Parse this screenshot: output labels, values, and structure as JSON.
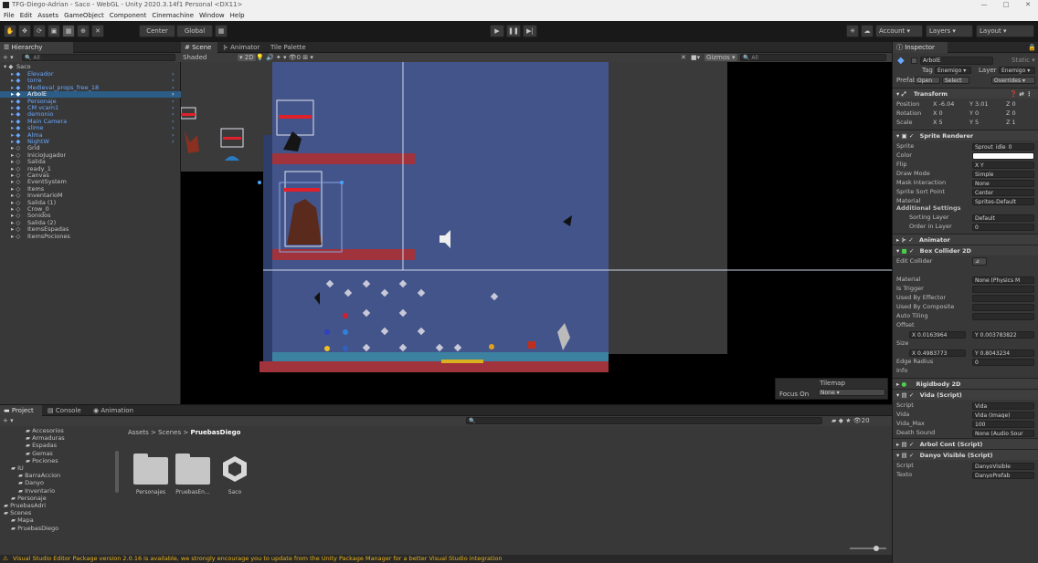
{
  "window": {
    "title": "TFG-Diego-Adrian - Saco - WebGL - Unity 2020.3.14f1 Personal <DX11>",
    "minimize": "—",
    "maximize": "□",
    "close": "✕"
  },
  "menu": [
    "File",
    "Edit",
    "Assets",
    "GameObject",
    "Component",
    "Cinemachine",
    "Window",
    "Help"
  ],
  "toolbar": {
    "center": "Center",
    "global": "Global",
    "account": "Account",
    "layers": "Layers",
    "layout": "Layout"
  },
  "hierarchy": {
    "tab": "Hierarchy",
    "search_placeholder": "All",
    "scene": "Saco",
    "items": [
      {
        "label": "Elevador",
        "blue": true
      },
      {
        "label": "torre",
        "blue": true
      },
      {
        "label": "Medieval_props_free_18",
        "blue": true
      },
      {
        "label": "ArbolE",
        "blue": true,
        "selected": true
      },
      {
        "label": "Personaje",
        "blue": true
      },
      {
        "label": "CM vcam1",
        "blue": true
      },
      {
        "label": "demonio",
        "blue": true
      },
      {
        "label": "Main Camera",
        "blue": true
      },
      {
        "label": "slime",
        "blue": true
      },
      {
        "label": "Alma",
        "blue": true
      },
      {
        "label": "NightW",
        "blue": true
      },
      {
        "label": "Grid",
        "blue": false
      },
      {
        "label": "InicioJugador",
        "blue": false
      },
      {
        "label": "Salida",
        "blue": false
      },
      {
        "label": "ready_1",
        "blue": false
      },
      {
        "label": "Canvas",
        "blue": false
      },
      {
        "label": "EventSystem",
        "blue": false
      },
      {
        "label": "Items",
        "blue": false
      },
      {
        "label": "InventarioM",
        "blue": false
      },
      {
        "label": "Salida (1)",
        "blue": false
      },
      {
        "label": "Crow_0",
        "blue": false
      },
      {
        "label": "Sonidos",
        "blue": false
      },
      {
        "label": "Salida (2)",
        "blue": false
      },
      {
        "label": "ItemsEspadas",
        "blue": false
      },
      {
        "label": "ItemsPociones",
        "blue": false
      }
    ]
  },
  "scene_view": {
    "tabs": [
      "Scene",
      "Animator",
      "Tile Palette"
    ],
    "shading": "Shaded",
    "mode_2d": "2D",
    "gizmos": "Gizmos",
    "search_placeholder": "All",
    "tilemap_title": "Tilemap",
    "focus_on": "Focus On",
    "focus_value": "None"
  },
  "inspector": {
    "tab": "Inspector",
    "object_name": "ArbolE",
    "static_label": "Static",
    "tag_label": "Tag",
    "tag_value": "Enemigo",
    "layer_label": "Layer",
    "layer_value": "Enemigo",
    "prefab_label": "Prefab",
    "open": "Open",
    "select": "Select",
    "overrides": "Overrides",
    "transform": {
      "title": "Transform",
      "position_label": "Position",
      "position": {
        "x": "-6.04",
        "y": "3.01",
        "z": "0"
      },
      "rotation_label": "Rotation",
      "rotation": {
        "x": "0",
        "y": "0",
        "z": "0"
      },
      "scale_label": "Scale",
      "scale": {
        "x": "5",
        "y": "5",
        "z": "1"
      }
    },
    "sprite_renderer": {
      "title": "Sprite Renderer",
      "rows": [
        {
          "label": "Sprite",
          "value": "Sprout_idle_0"
        },
        {
          "label": "Color",
          "value": ""
        },
        {
          "label": "Flip",
          "value": "X   Y"
        },
        {
          "label": "Draw Mode",
          "value": "Simple"
        },
        {
          "label": "Mask Interaction",
          "value": "None"
        },
        {
          "label": "Sprite Sort Point",
          "value": "Center"
        },
        {
          "label": "Material",
          "value": "Sprites-Default"
        }
      ],
      "additional": "Additional Settings",
      "sorting_layer_label": "Sorting Layer",
      "sorting_layer": "Default",
      "order_label": "Order in Layer",
      "order": "0"
    },
    "animator": {
      "title": "Animator"
    },
    "box_collider": {
      "title": "Box Collider 2D",
      "edit_collider": "Edit Collider",
      "rows": [
        {
          "label": "Material",
          "value": "None (Physics M"
        },
        {
          "label": "Is Trigger",
          "value": ""
        },
        {
          "label": "Used By Effector",
          "value": ""
        },
        {
          "label": "Used By Composite",
          "value": ""
        },
        {
          "label": "Auto Tiling",
          "value": ""
        }
      ],
      "offset_label": "Offset",
      "offset": {
        "x": "0.0163964",
        "y": "0.003783822"
      },
      "size_label": "Size",
      "size": {
        "x": "0.4983773",
        "y": "0.8043234"
      },
      "edge_radius_label": "Edge Radius",
      "edge_radius": "0",
      "info": "Info"
    },
    "rigidbody": {
      "title": "Rigidbody 2D"
    },
    "vida": {
      "title": "Vida (Script)",
      "rows": [
        {
          "label": "Script",
          "value": "Vida"
        },
        {
          "label": "Vida",
          "value": "Vida (Image)"
        },
        {
          "label": "Vida_Max",
          "value": "100"
        },
        {
          "label": "Death Sound",
          "value": "None (Audio Sour"
        }
      ]
    },
    "arbol_cont": {
      "title": "Arbol Cont (Script)"
    },
    "danyo_visible": {
      "title": "Danyo Visible (Script)",
      "rows": [
        {
          "label": "Script",
          "value": "DanyoVisible"
        },
        {
          "label": "Texto",
          "value": "DanyoPrefab"
        }
      ]
    }
  },
  "project": {
    "tabs": [
      "Project",
      "Console",
      "Animation"
    ],
    "breadcrumb": [
      "Assets",
      "Scenes",
      "PruebasDiego"
    ],
    "tree": [
      {
        "label": "Accesorios",
        "indent": 3
      },
      {
        "label": "Armaduras",
        "indent": 3
      },
      {
        "label": "Espadas",
        "indent": 3
      },
      {
        "label": "Gemas",
        "indent": 3
      },
      {
        "label": "Pociones",
        "indent": 3
      },
      {
        "label": "IU",
        "indent": 1
      },
      {
        "label": "BarraAccion",
        "indent": 2
      },
      {
        "label": "Danyo",
        "indent": 2
      },
      {
        "label": "Inventario",
        "indent": 2
      },
      {
        "label": "Personaje",
        "indent": 1
      },
      {
        "label": "PruebasAdri",
        "indent": 0
      },
      {
        "label": "Scenes",
        "indent": 0
      },
      {
        "label": "Mapa",
        "indent": 1
      },
      {
        "label": "PruebasDiego",
        "indent": 1
      }
    ],
    "assets": [
      "Personajes",
      "PruebasEn...",
      "Saco"
    ],
    "count": "20"
  },
  "status": {
    "message": "Visual Studio Editor Package version 2.0.16 is available, we strongly encourage you to update from the Unity Package Manager for a better Visual Studio integration"
  }
}
